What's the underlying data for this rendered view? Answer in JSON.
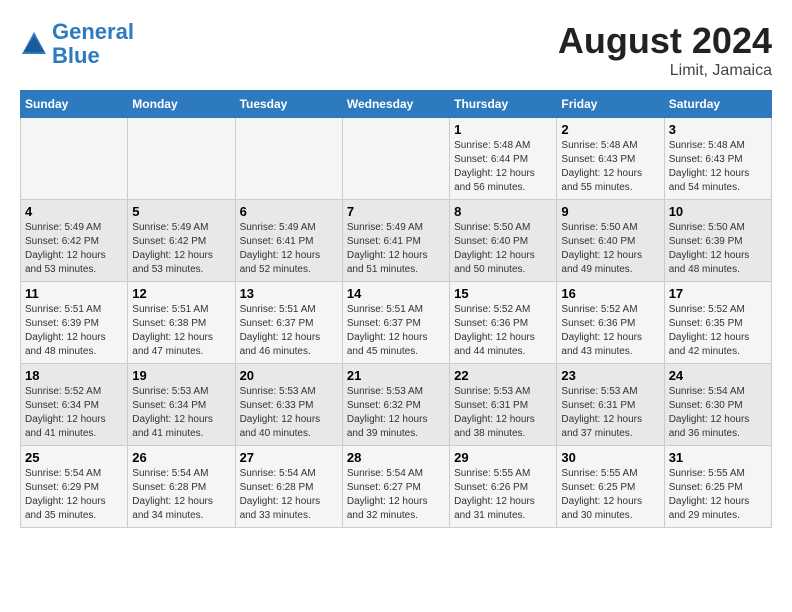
{
  "header": {
    "logo_line1": "General",
    "logo_line2": "Blue",
    "month_year": "August 2024",
    "location": "Limit, Jamaica"
  },
  "weekdays": [
    "Sunday",
    "Monday",
    "Tuesday",
    "Wednesday",
    "Thursday",
    "Friday",
    "Saturday"
  ],
  "weeks": [
    [
      {
        "day": "",
        "sunrise": "",
        "sunset": "",
        "daylight": ""
      },
      {
        "day": "",
        "sunrise": "",
        "sunset": "",
        "daylight": ""
      },
      {
        "day": "",
        "sunrise": "",
        "sunset": "",
        "daylight": ""
      },
      {
        "day": "",
        "sunrise": "",
        "sunset": "",
        "daylight": ""
      },
      {
        "day": "1",
        "sunrise": "Sunrise: 5:48 AM",
        "sunset": "Sunset: 6:44 PM",
        "daylight": "Daylight: 12 hours and 56 minutes."
      },
      {
        "day": "2",
        "sunrise": "Sunrise: 5:48 AM",
        "sunset": "Sunset: 6:43 PM",
        "daylight": "Daylight: 12 hours and 55 minutes."
      },
      {
        "day": "3",
        "sunrise": "Sunrise: 5:48 AM",
        "sunset": "Sunset: 6:43 PM",
        "daylight": "Daylight: 12 hours and 54 minutes."
      }
    ],
    [
      {
        "day": "4",
        "sunrise": "Sunrise: 5:49 AM",
        "sunset": "Sunset: 6:42 PM",
        "daylight": "Daylight: 12 hours and 53 minutes."
      },
      {
        "day": "5",
        "sunrise": "Sunrise: 5:49 AM",
        "sunset": "Sunset: 6:42 PM",
        "daylight": "Daylight: 12 hours and 53 minutes."
      },
      {
        "day": "6",
        "sunrise": "Sunrise: 5:49 AM",
        "sunset": "Sunset: 6:41 PM",
        "daylight": "Daylight: 12 hours and 52 minutes."
      },
      {
        "day": "7",
        "sunrise": "Sunrise: 5:49 AM",
        "sunset": "Sunset: 6:41 PM",
        "daylight": "Daylight: 12 hours and 51 minutes."
      },
      {
        "day": "8",
        "sunrise": "Sunrise: 5:50 AM",
        "sunset": "Sunset: 6:40 PM",
        "daylight": "Daylight: 12 hours and 50 minutes."
      },
      {
        "day": "9",
        "sunrise": "Sunrise: 5:50 AM",
        "sunset": "Sunset: 6:40 PM",
        "daylight": "Daylight: 12 hours and 49 minutes."
      },
      {
        "day": "10",
        "sunrise": "Sunrise: 5:50 AM",
        "sunset": "Sunset: 6:39 PM",
        "daylight": "Daylight: 12 hours and 48 minutes."
      }
    ],
    [
      {
        "day": "11",
        "sunrise": "Sunrise: 5:51 AM",
        "sunset": "Sunset: 6:39 PM",
        "daylight": "Daylight: 12 hours and 48 minutes."
      },
      {
        "day": "12",
        "sunrise": "Sunrise: 5:51 AM",
        "sunset": "Sunset: 6:38 PM",
        "daylight": "Daylight: 12 hours and 47 minutes."
      },
      {
        "day": "13",
        "sunrise": "Sunrise: 5:51 AM",
        "sunset": "Sunset: 6:37 PM",
        "daylight": "Daylight: 12 hours and 46 minutes."
      },
      {
        "day": "14",
        "sunrise": "Sunrise: 5:51 AM",
        "sunset": "Sunset: 6:37 PM",
        "daylight": "Daylight: 12 hours and 45 minutes."
      },
      {
        "day": "15",
        "sunrise": "Sunrise: 5:52 AM",
        "sunset": "Sunset: 6:36 PM",
        "daylight": "Daylight: 12 hours and 44 minutes."
      },
      {
        "day": "16",
        "sunrise": "Sunrise: 5:52 AM",
        "sunset": "Sunset: 6:36 PM",
        "daylight": "Daylight: 12 hours and 43 minutes."
      },
      {
        "day": "17",
        "sunrise": "Sunrise: 5:52 AM",
        "sunset": "Sunset: 6:35 PM",
        "daylight": "Daylight: 12 hours and 42 minutes."
      }
    ],
    [
      {
        "day": "18",
        "sunrise": "Sunrise: 5:52 AM",
        "sunset": "Sunset: 6:34 PM",
        "daylight": "Daylight: 12 hours and 41 minutes."
      },
      {
        "day": "19",
        "sunrise": "Sunrise: 5:53 AM",
        "sunset": "Sunset: 6:34 PM",
        "daylight": "Daylight: 12 hours and 41 minutes."
      },
      {
        "day": "20",
        "sunrise": "Sunrise: 5:53 AM",
        "sunset": "Sunset: 6:33 PM",
        "daylight": "Daylight: 12 hours and 40 minutes."
      },
      {
        "day": "21",
        "sunrise": "Sunrise: 5:53 AM",
        "sunset": "Sunset: 6:32 PM",
        "daylight": "Daylight: 12 hours and 39 minutes."
      },
      {
        "day": "22",
        "sunrise": "Sunrise: 5:53 AM",
        "sunset": "Sunset: 6:31 PM",
        "daylight": "Daylight: 12 hours and 38 minutes."
      },
      {
        "day": "23",
        "sunrise": "Sunrise: 5:53 AM",
        "sunset": "Sunset: 6:31 PM",
        "daylight": "Daylight: 12 hours and 37 minutes."
      },
      {
        "day": "24",
        "sunrise": "Sunrise: 5:54 AM",
        "sunset": "Sunset: 6:30 PM",
        "daylight": "Daylight: 12 hours and 36 minutes."
      }
    ],
    [
      {
        "day": "25",
        "sunrise": "Sunrise: 5:54 AM",
        "sunset": "Sunset: 6:29 PM",
        "daylight": "Daylight: 12 hours and 35 minutes."
      },
      {
        "day": "26",
        "sunrise": "Sunrise: 5:54 AM",
        "sunset": "Sunset: 6:28 PM",
        "daylight": "Daylight: 12 hours and 34 minutes."
      },
      {
        "day": "27",
        "sunrise": "Sunrise: 5:54 AM",
        "sunset": "Sunset: 6:28 PM",
        "daylight": "Daylight: 12 hours and 33 minutes."
      },
      {
        "day": "28",
        "sunrise": "Sunrise: 5:54 AM",
        "sunset": "Sunset: 6:27 PM",
        "daylight": "Daylight: 12 hours and 32 minutes."
      },
      {
        "day": "29",
        "sunrise": "Sunrise: 5:55 AM",
        "sunset": "Sunset: 6:26 PM",
        "daylight": "Daylight: 12 hours and 31 minutes."
      },
      {
        "day": "30",
        "sunrise": "Sunrise: 5:55 AM",
        "sunset": "Sunset: 6:25 PM",
        "daylight": "Daylight: 12 hours and 30 minutes."
      },
      {
        "day": "31",
        "sunrise": "Sunrise: 5:55 AM",
        "sunset": "Sunset: 6:25 PM",
        "daylight": "Daylight: 12 hours and 29 minutes."
      }
    ]
  ]
}
